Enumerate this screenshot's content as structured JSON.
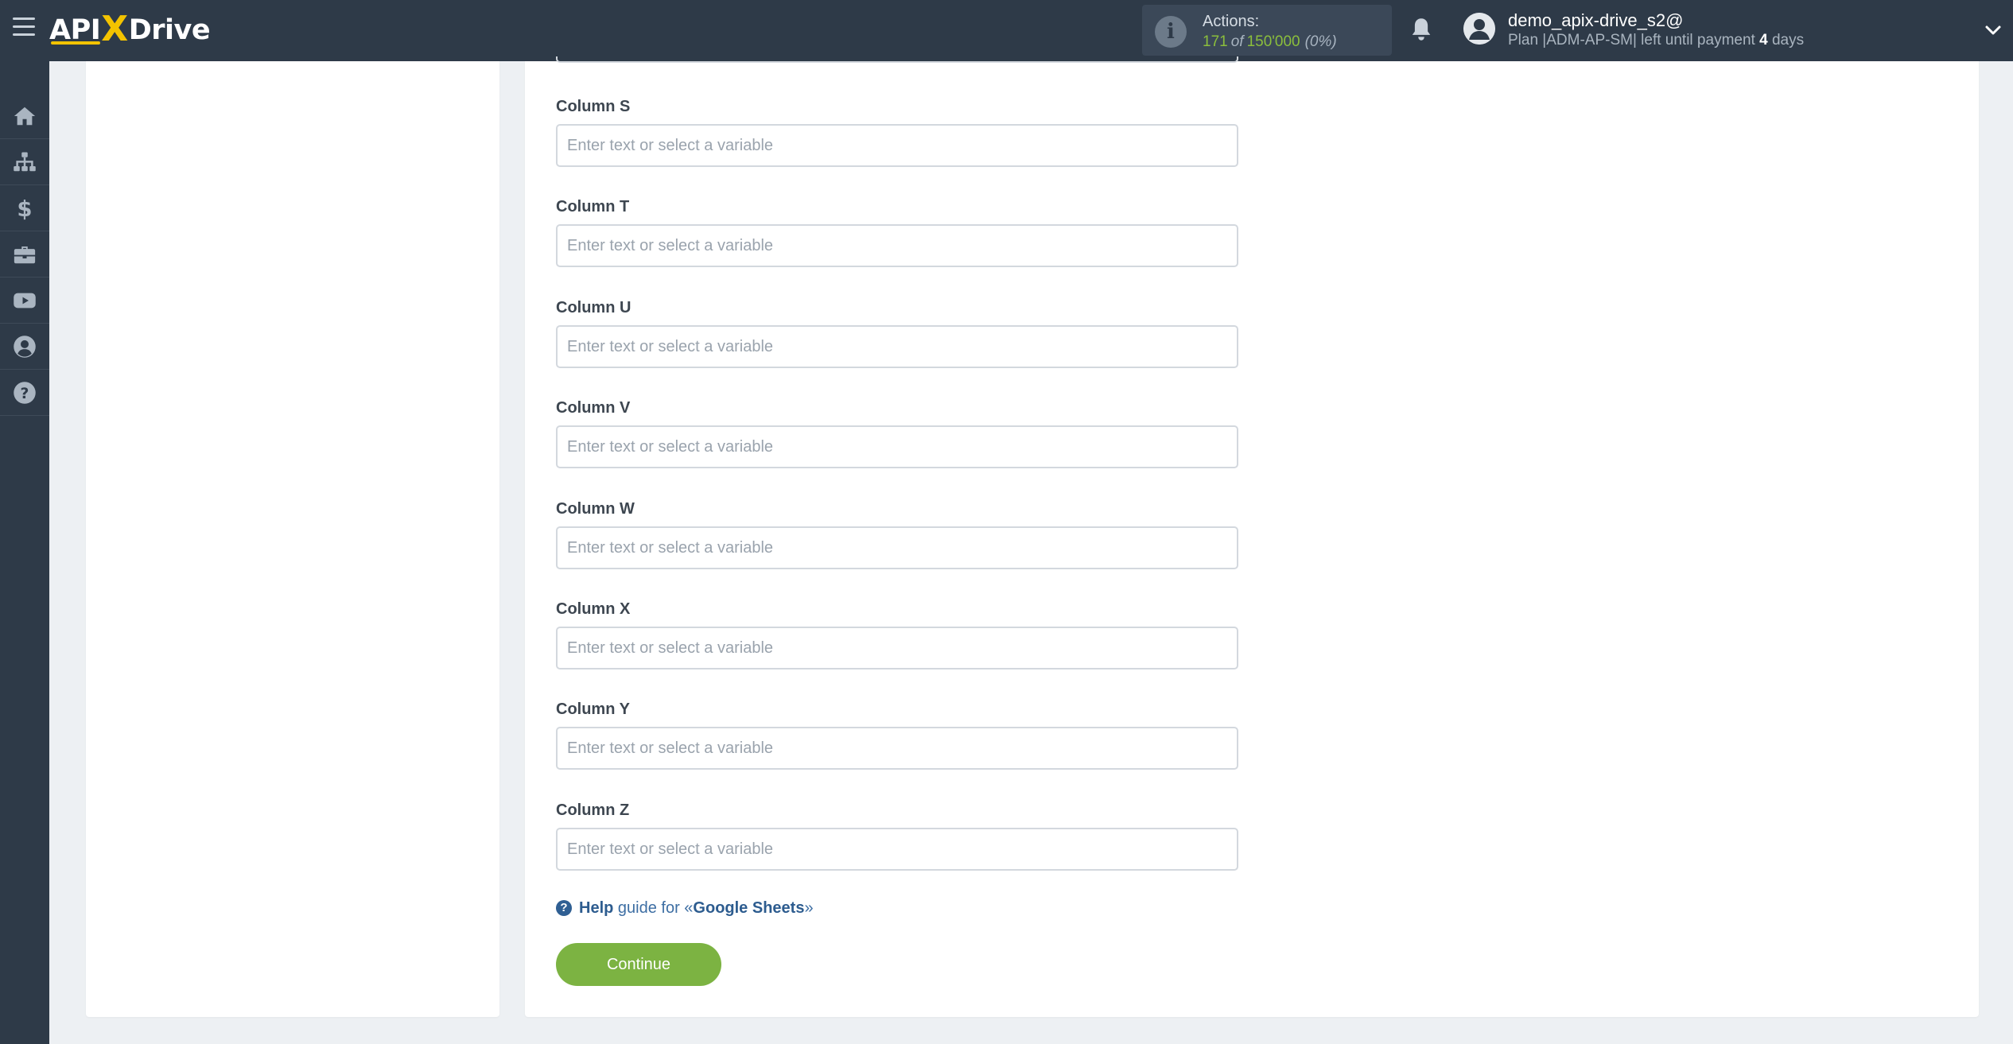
{
  "header": {
    "logo": {
      "part1": "API",
      "part2": "X",
      "part3": "Drive"
    },
    "actions": {
      "title": "Actions:",
      "used": "171",
      "of": "of",
      "total": "150'000",
      "percent": "(0%)"
    },
    "user": {
      "name": "demo_apix-drive_s2@",
      "plan_prefix": "Plan |ADM-AP-SM| left until payment",
      "days_number": "4",
      "days_suffix": "days"
    }
  },
  "sidebar": {
    "items": [
      {
        "icon": "home-icon"
      },
      {
        "icon": "sitemap-icon"
      },
      {
        "icon": "dollar-icon"
      },
      {
        "icon": "briefcase-icon"
      },
      {
        "icon": "youtube-icon"
      },
      {
        "icon": "user-circle-icon"
      },
      {
        "icon": "question-icon"
      }
    ]
  },
  "form": {
    "fields": [
      {
        "label": "Column S",
        "value": "",
        "placeholder": "Enter text or select a variable"
      },
      {
        "label": "Column T",
        "value": "",
        "placeholder": "Enter text or select a variable"
      },
      {
        "label": "Column U",
        "value": "",
        "placeholder": "Enter text or select a variable"
      },
      {
        "label": "Column V",
        "value": "",
        "placeholder": "Enter text or select a variable"
      },
      {
        "label": "Column W",
        "value": "",
        "placeholder": "Enter text or select a variable"
      },
      {
        "label": "Column X",
        "value": "",
        "placeholder": "Enter text or select a variable"
      },
      {
        "label": "Column Y",
        "value": "",
        "placeholder": "Enter text or select a variable"
      },
      {
        "label": "Column Z",
        "value": "",
        "placeholder": "Enter text or select a variable"
      }
    ],
    "help": {
      "prefix": "Help",
      "middle": "guide for «",
      "service": "Google Sheets",
      "suffix": "»"
    },
    "continue_label": "Continue"
  },
  "colors": {
    "topbar": "#2e3a48",
    "accent_green": "#7cb342",
    "logo_yellow": "#f3c300",
    "link_blue": "#2d5c8f"
  }
}
